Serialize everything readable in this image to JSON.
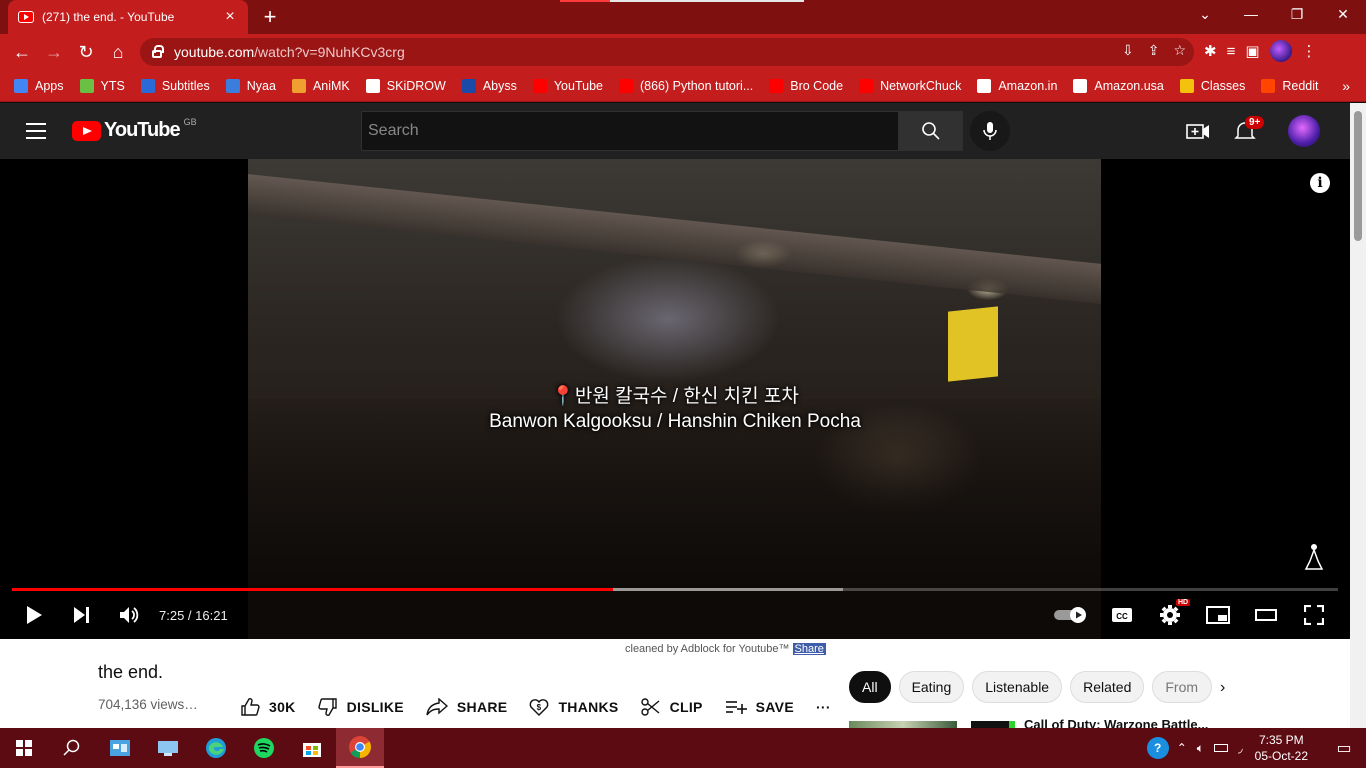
{
  "browser": {
    "tab_title": "(271) the end. - YouTube",
    "new_tab": "+",
    "url_host": "youtube.com",
    "url_path": "/watch?v=9NuhKCv3crg",
    "bookmarks": [
      {
        "label": "Apps",
        "color": "#4285f4"
      },
      {
        "label": "YTS",
        "color": "#6ac045"
      },
      {
        "label": "Subtitles",
        "color": "#2a6ad6"
      },
      {
        "label": "Nyaa",
        "color": "#3b7ddd"
      },
      {
        "label": "AniMK",
        "color": "#f0a030"
      },
      {
        "label": "SKiDROW",
        "color": "#ffffff"
      },
      {
        "label": "Abyss",
        "color": "#1b4aa8"
      },
      {
        "label": "YouTube",
        "color": "#ff0000"
      },
      {
        "label": "(866) Python tutori...",
        "color": "#ff0000"
      },
      {
        "label": "Bro Code",
        "color": "#ff0000"
      },
      {
        "label": "NetworkChuck",
        "color": "#ff0000"
      },
      {
        "label": "Amazon.in",
        "color": "#ffffff"
      },
      {
        "label": "Amazon.usa",
        "color": "#ffffff"
      },
      {
        "label": "Classes",
        "color": "#f4c20d"
      },
      {
        "label": "Reddit",
        "color": "#ff4500"
      }
    ],
    "more": "»"
  },
  "youtube": {
    "logo_text": "YouTube",
    "country": "GB",
    "search_placeholder": "Search",
    "notification_count": "9+"
  },
  "player": {
    "caption_line1": "📍반원 칼국수 / 한신 치킨 포차",
    "caption_line2": "Banwon Kalgooksu / Hanshin Chiken Pocha",
    "time": "7:25 / 16:21",
    "played_fraction": 0.4535,
    "buffered_fraction": 0.627,
    "quality_badge": "HD"
  },
  "video": {
    "title": "the end.",
    "views": "704,136 views…",
    "adblock_text": "cleaned by Adblock for Youtube™",
    "adblock_share": "Share",
    "likes": "30K",
    "dislike_label": "DISLIKE",
    "share_label": "SHARE",
    "thanks_label": "THANKS",
    "clip_label": "CLIP",
    "save_label": "SAVE",
    "more": "···"
  },
  "chips": [
    "All",
    "Eating",
    "Listenable",
    "Related",
    "From"
  ],
  "recommendation_peek": "Call of Duty: Warzone Battle...",
  "taskbar": {
    "time": "7:35 PM",
    "date": "05-Oct-22"
  }
}
